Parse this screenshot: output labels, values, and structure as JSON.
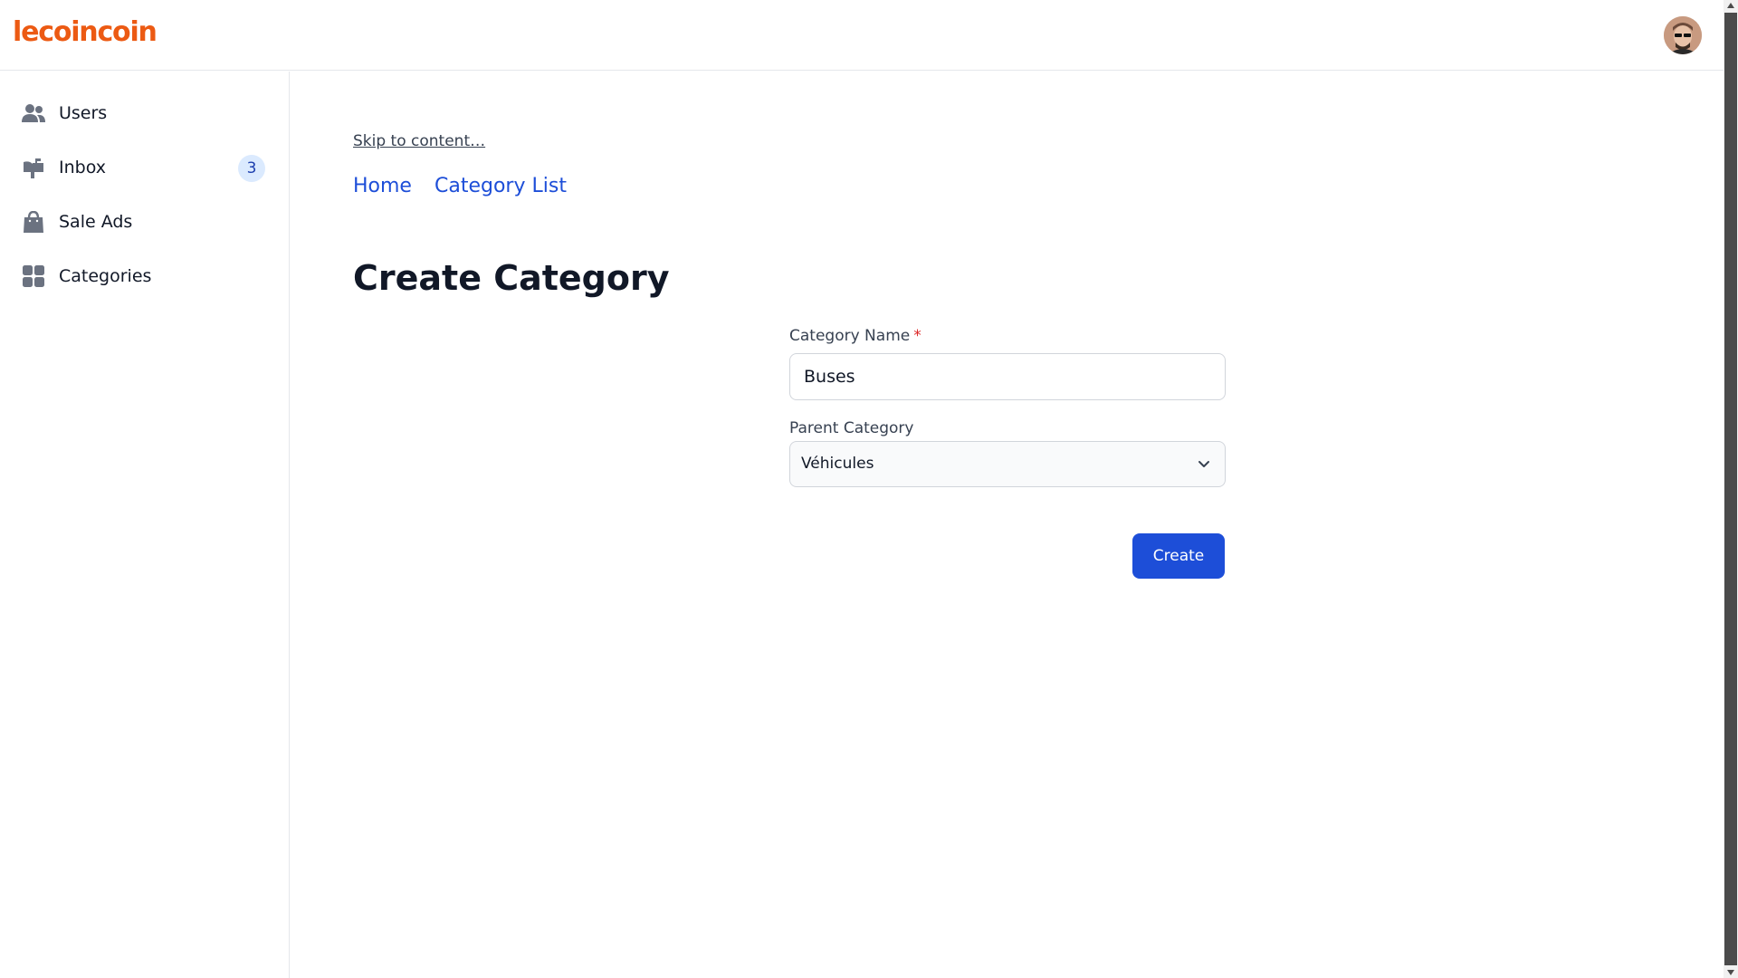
{
  "app": {
    "logo_text": "lecoincoin",
    "brand_color": "#ec5a13"
  },
  "header": {
    "avatar_icon": "user-avatar"
  },
  "sidebar": {
    "items": [
      {
        "label": "Users",
        "icon": "users-icon"
      },
      {
        "label": "Inbox",
        "icon": "mailbox-icon",
        "badge": "3"
      },
      {
        "label": "Sale Ads",
        "icon": "shopping-bag-icon"
      },
      {
        "label": "Categories",
        "icon": "grid-icon"
      }
    ]
  },
  "main": {
    "skip_link": "Skip to content…",
    "breadcrumb": [
      "Home",
      "Category List"
    ],
    "title": "Create Category",
    "form": {
      "name_label": "Category Name",
      "required_mark": "*",
      "name_value": "Buses",
      "parent_label": "Parent Category",
      "parent_value": "Véhicules",
      "submit_label": "Create"
    }
  },
  "colors": {
    "primary": "#1d4ed8",
    "badge_bg": "#dbeafe",
    "required": "#dc2626"
  }
}
